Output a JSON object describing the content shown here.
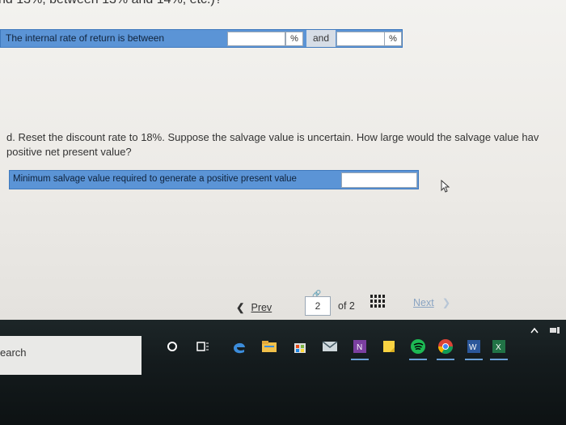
{
  "header": {
    "cut_text": "nd 13%, between 13% and 14%, etc.)?"
  },
  "irr": {
    "label": "The internal rate of return is between",
    "pct1": "%",
    "and_label": "and",
    "pct2": "%"
  },
  "question_d": {
    "line1": "d. Reset the discount rate to 18%. Suppose the salvage value is uncertain. How large would the salvage value hav",
    "line2": "positive net present value?"
  },
  "salvage": {
    "label": "Minimum salvage value required to generate a positive present value"
  },
  "nav": {
    "prev_label": "Prev",
    "page_current": "2",
    "of_label": "of 2",
    "next_label": "Next"
  },
  "taskbar": {
    "search_text": "earch",
    "icons": [
      "cortana-icon",
      "task-view-icon",
      "edge-icon",
      "file-explorer-icon",
      "store-icon",
      "mail-icon",
      "onenote-icon",
      "sticky-notes-icon",
      "spotify-icon",
      "chrome-icon",
      "word-icon",
      "excel-icon"
    ]
  },
  "colors": {
    "answer_row": "#5b94d6",
    "taskbar": "#141b1d"
  }
}
